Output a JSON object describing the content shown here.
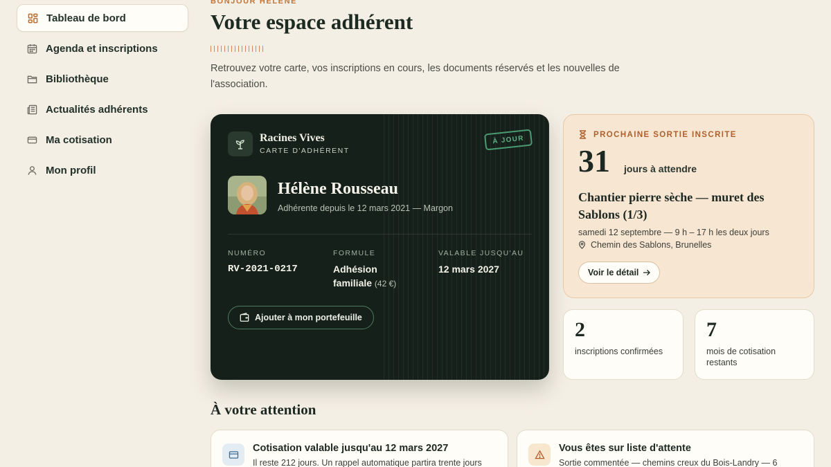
{
  "sidebar": {
    "items": [
      {
        "label": "Tableau de bord",
        "icon": "dashboard-icon",
        "active": true
      },
      {
        "label": "Agenda et inscriptions",
        "icon": "calendar-icon"
      },
      {
        "label": "Bibliothèque",
        "icon": "folder-icon"
      },
      {
        "label": "Actualités adhérents",
        "icon": "newspaper-icon"
      },
      {
        "label": "Ma cotisation",
        "icon": "credit-card-icon"
      },
      {
        "label": "Mon profil",
        "icon": "user-icon"
      }
    ]
  },
  "header": {
    "greeting": "BONJOUR HÉLÈNE",
    "title": "Votre espace adhérent",
    "intro": "Retrouvez votre carte, vos inscriptions en cours, les documents réservés et les nouvelles de l'association."
  },
  "member_card": {
    "brand_name": "Racines Vives",
    "brand_sub": "CARTE D'ADHÉRENT",
    "stamp": "À JOUR",
    "name": "Hélène Rousseau",
    "since": "Adhérente depuis le 12 mars 2021 — Margon",
    "number_label": "NUMÉRO",
    "number": "RV-2021-0217",
    "plan_label": "FORMULE",
    "plan": "Adhésion familiale",
    "plan_price": "(42 €)",
    "valid_label": "VALABLE JUSQU'AU",
    "valid_until": "12 mars 2027",
    "wallet_button": "Ajouter à mon portefeuille"
  },
  "next_outing": {
    "eyebrow": "PROCHAINE SORTIE INSCRITE",
    "days": "31",
    "days_label": "jours à attendre",
    "title": "Chantier pierre sèche — muret des Sablons (1/3)",
    "date": "samedi 12 septembre — 9 h – 17 h les deux jours",
    "place": "Chemin des Sablons, Brunelles",
    "detail_button": "Voir le détail"
  },
  "stats": [
    {
      "value": "2",
      "label": "inscriptions confirmées"
    },
    {
      "value": "7",
      "label": "mois de cotisation restants"
    }
  ],
  "attention": {
    "title": "À votre attention",
    "notices": [
      {
        "title": "Cotisation valable jusqu'au 12 mars 2027",
        "text": "Il reste 212 jours. Un rappel automatique partira trente jours",
        "icon": "credit-card-icon"
      },
      {
        "title": "Vous êtes sur liste d'attente",
        "text": "Sortie commentée — chemins creux du Bois-Landry — 6",
        "icon": "warning-icon"
      }
    ]
  },
  "colors": {
    "background": "#f4efe4",
    "accent": "#c0763a",
    "card": "#16201a",
    "stamp": "#4a9a72"
  }
}
